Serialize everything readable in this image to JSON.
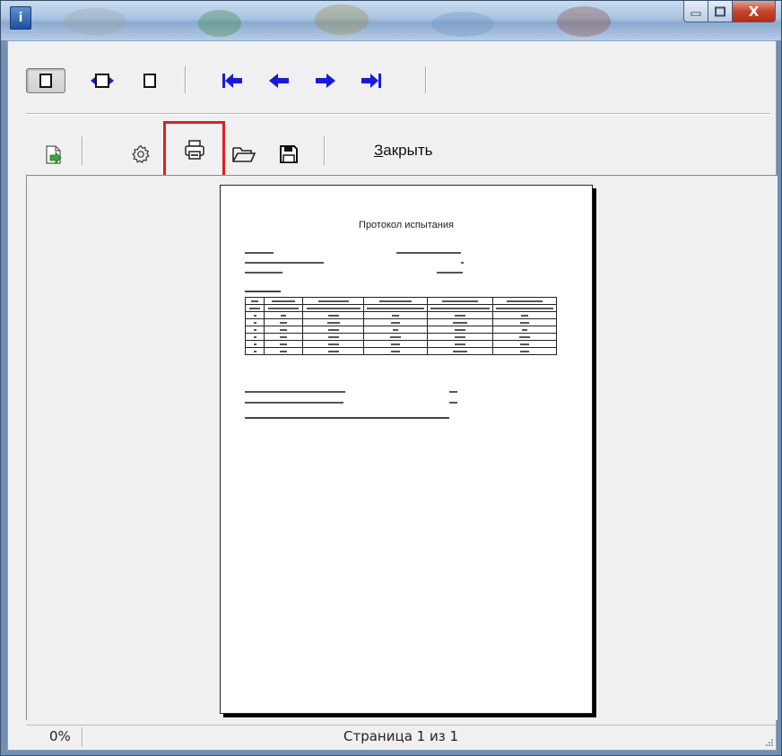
{
  "window": {
    "title": "",
    "close_glyph": "X",
    "app_icon_glyph": "i"
  },
  "toolbar_nav": {
    "buttons": [
      {
        "name": "one-page-view-button",
        "icon": "single-page-icon",
        "pressed": true
      },
      {
        "name": "fit-width-button",
        "icon": "fit-width-icon"
      },
      {
        "name": "page-width-button",
        "icon": "page-width-icon"
      },
      {
        "name": "first-page-button",
        "icon": "first-page-icon"
      },
      {
        "name": "prev-page-button",
        "icon": "arrow-left-icon"
      },
      {
        "name": "next-page-button",
        "icon": "arrow-right-icon"
      },
      {
        "name": "last-page-button",
        "icon": "last-page-icon"
      }
    ],
    "arrow_color": "#1818e6"
  },
  "toolbar_actions": {
    "export_icon": "export-icon",
    "settings_icon": "gear-icon",
    "print_icon": "printer-icon",
    "open_icon": "folder-icon",
    "save_icon": "floppy-icon",
    "close_label_underlined": "З",
    "close_label_rest": "акрыть",
    "highlight_color": "#e02020"
  },
  "document": {
    "title": "Протокол испытания",
    "table": {
      "rows": [
        [
          "",
          "",
          "",
          "",
          "",
          ""
        ],
        [
          "",
          "",
          "",
          "",
          "",
          ""
        ],
        [
          "",
          "",
          "",
          "",
          "",
          ""
        ],
        [
          "",
          "",
          "",
          "",
          "",
          ""
        ],
        [
          "",
          "",
          "",
          "",
          "",
          ""
        ],
        [
          "",
          "",
          "",
          "",
          "",
          ""
        ],
        [
          "",
          "",
          "",
          "",
          "",
          ""
        ],
        [
          "",
          "",
          "",
          "",
          "",
          ""
        ]
      ]
    }
  },
  "statusbar": {
    "zoom": "0%",
    "page_info": "Страница 1 из 1"
  }
}
